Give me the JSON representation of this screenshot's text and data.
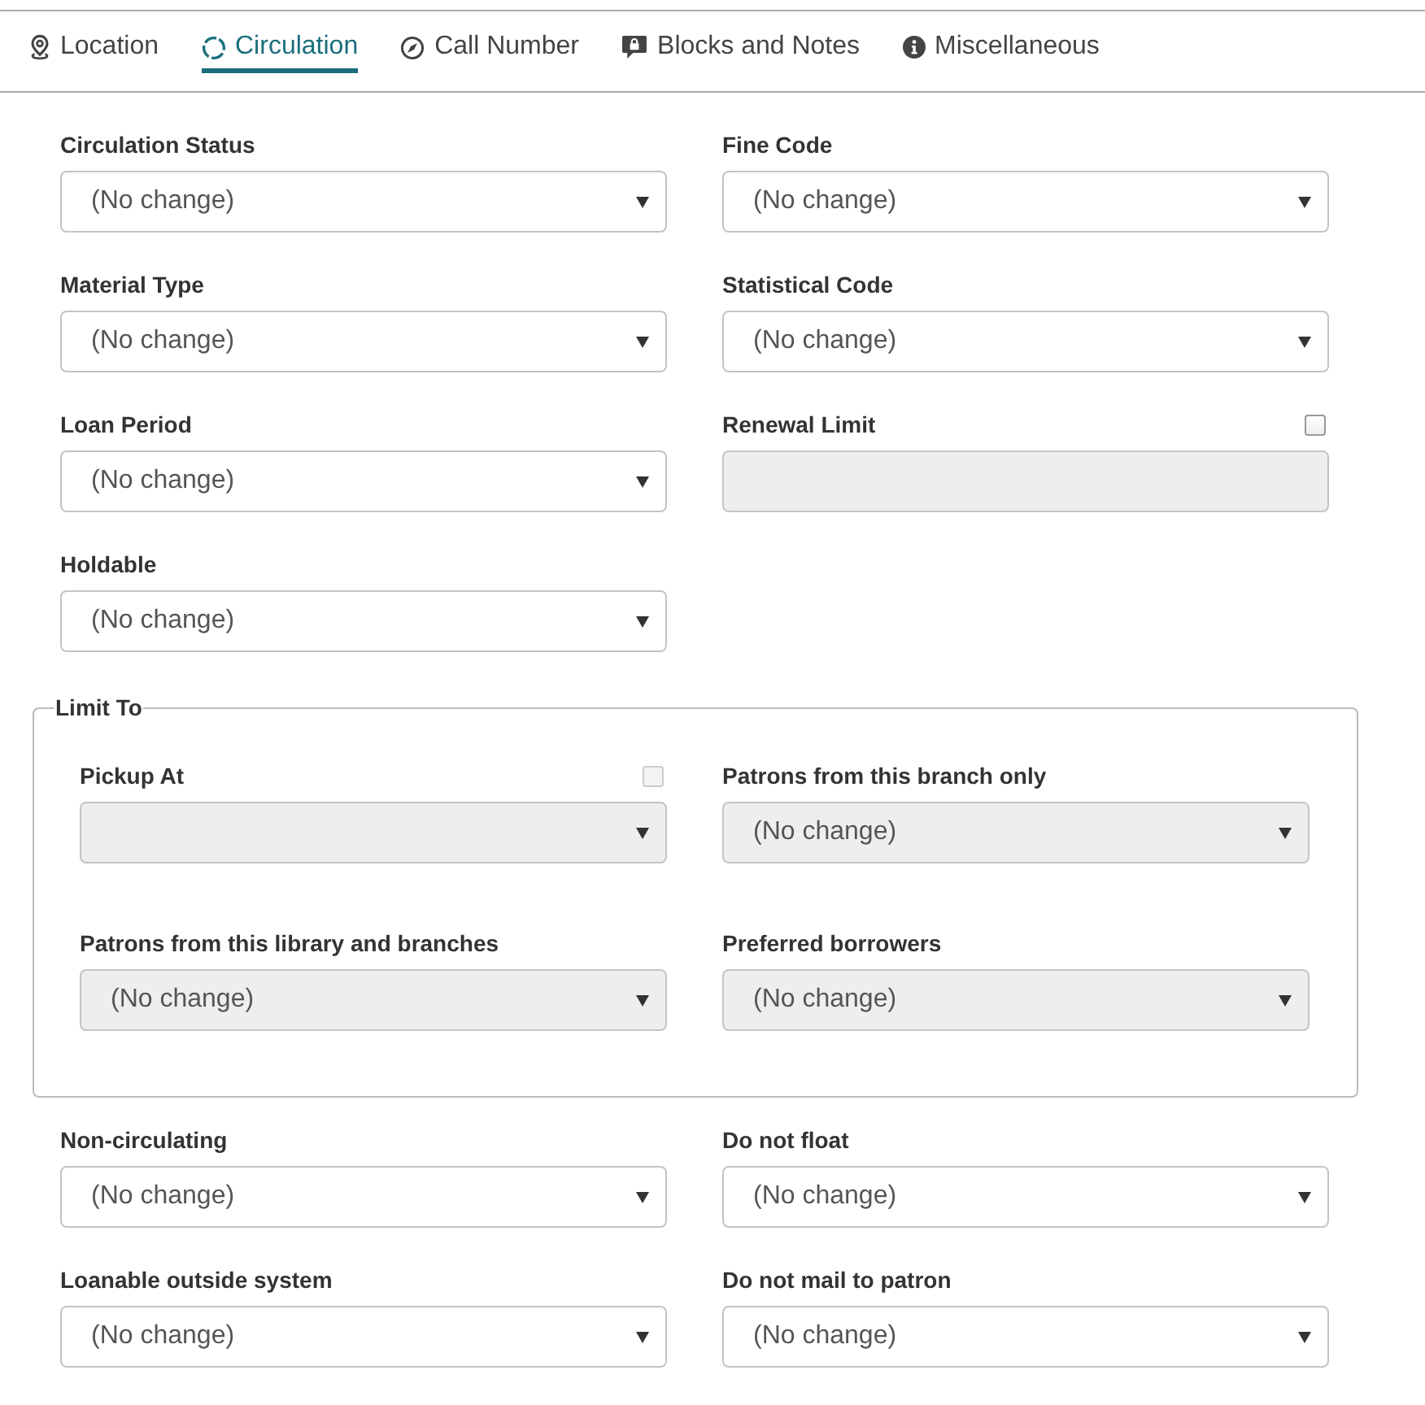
{
  "tabs": [
    {
      "label": "Location",
      "selected": false
    },
    {
      "label": "Circulation",
      "selected": true
    },
    {
      "label": "Call Number",
      "selected": false
    },
    {
      "label": "Blocks and Notes",
      "selected": false
    },
    {
      "label": "Miscellaneous",
      "selected": false
    }
  ],
  "fields": [
    {
      "label": "Circulation Status",
      "kind": "select",
      "value": "(No change)",
      "disabled": false
    },
    {
      "label": "Fine Code",
      "kind": "select",
      "value": "(No change)",
      "disabled": false
    },
    {
      "label": "Material Type",
      "kind": "select",
      "value": "(No change)",
      "disabled": false
    },
    {
      "label": "Statistical Code",
      "kind": "select",
      "value": "(No change)",
      "disabled": false
    },
    {
      "label": "Loan Period",
      "kind": "select",
      "value": "(No change)",
      "disabled": false
    },
    {
      "label": "Renewal Limit",
      "kind": "text",
      "disabled": true,
      "toggle": {
        "checked": false,
        "disabled": false
      }
    },
    {
      "label": "Holdable",
      "kind": "select",
      "value": "(No change)",
      "disabled": false
    }
  ],
  "limit_to": {
    "legend": "Limit To",
    "fields": [
      {
        "label": "Pickup At",
        "kind": "select",
        "disabled": true,
        "toggle": {
          "checked": false,
          "disabled": true
        }
      },
      {
        "label": "Patrons from this branch only",
        "kind": "select",
        "value": "(No change)",
        "disabled": true
      },
      {
        "label": "Patrons from this library and branches",
        "kind": "select",
        "value": "(No change)",
        "disabled": true
      },
      {
        "label": "Preferred borrowers",
        "kind": "select",
        "value": "(No change)",
        "disabled": true
      }
    ]
  },
  "more_fields": [
    {
      "label": "Non-circulating",
      "kind": "select",
      "value": "(No change)",
      "disabled": false
    },
    {
      "label": "Do not float",
      "kind": "select",
      "value": "(No change)",
      "disabled": false
    },
    {
      "label": "Loanable outside system",
      "kind": "select",
      "value": "(No change)",
      "disabled": false
    },
    {
      "label": "Do not mail to patron",
      "kind": "select",
      "value": "(No change)",
      "disabled": false
    }
  ]
}
